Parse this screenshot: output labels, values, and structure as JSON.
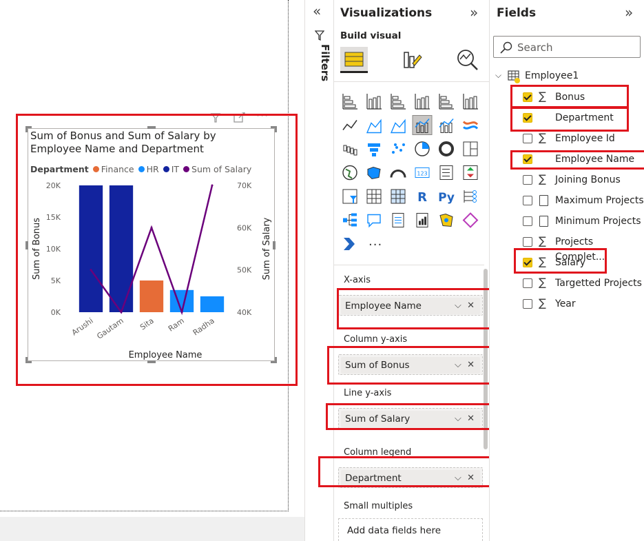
{
  "chart_data": {
    "type": "bar",
    "title": "Sum of Bonus and Sum of Salary by Employee Name and Department",
    "title_lines": [
      "Sum of Bonus and Sum of Salary by",
      "Employee Name and Department"
    ],
    "xlabel": "Employee Name",
    "ylabel": "Sum of Bonus",
    "y2label": "Sum of Salary",
    "ylim": [
      0,
      20000
    ],
    "y2lim": [
      40000,
      70000
    ],
    "yticks": [
      "0K",
      "5K",
      "10K",
      "15K",
      "20K"
    ],
    "y2ticks": [
      "40K",
      "50K",
      "60K",
      "70K"
    ],
    "legend_title": "Department",
    "legend": [
      {
        "name": "Finance",
        "color": "#e66c37"
      },
      {
        "name": "HR",
        "color": "#118dff"
      },
      {
        "name": "IT",
        "color": "#12239e"
      },
      {
        "name": "Sum of Salary",
        "color": "#6b007b"
      }
    ],
    "legend_position": "top-left",
    "grid": false,
    "categories": [
      "Arushi",
      "Gautam",
      "Sita",
      "Ram",
      "Radha"
    ],
    "bars": [
      {
        "category": "Arushi",
        "department": "IT",
        "value": 20000
      },
      {
        "category": "Gautam",
        "department": "IT",
        "value": 20000
      },
      {
        "category": "Sita",
        "department": "Finance",
        "value": 5000
      },
      {
        "category": "Ram",
        "department": "HR",
        "value": 3500
      },
      {
        "category": "Radha",
        "department": "HR",
        "value": 2500
      }
    ],
    "line": {
      "name": "Sum of Salary",
      "values": [
        50000,
        40000,
        60000,
        40000,
        70000
      ]
    }
  },
  "visual_header": {
    "filter_icon": "filter-icon",
    "focus_icon": "focus-mode-icon",
    "more": "···"
  },
  "filters": {
    "label": "Filters",
    "collapse": "«"
  },
  "viz": {
    "title": "Visualizations",
    "expand": "»",
    "build_visual": "Build visual",
    "more_visuals": "···",
    "wells": [
      {
        "label": "X-axis",
        "value": "Employee Name"
      },
      {
        "label": "Column y-axis",
        "value": "Sum of Bonus"
      },
      {
        "label": "Line y-axis",
        "value": "Sum of Salary"
      },
      {
        "label": "Column legend",
        "value": "Department"
      }
    ],
    "small_multiples": "Small multiples",
    "add_fields": "Add data fields here"
  },
  "fields": {
    "title": "Fields",
    "expand": "»",
    "search_placeholder": "Search",
    "table_name": "Employee1",
    "items": [
      {
        "name": "Bonus",
        "checked": true,
        "type": "sum"
      },
      {
        "name": "Department",
        "checked": true,
        "type": "text"
      },
      {
        "name": "Employee Id",
        "checked": false,
        "type": "sum"
      },
      {
        "name": "Employee Name",
        "checked": true,
        "type": "text"
      },
      {
        "name": "Joining Bonus",
        "checked": false,
        "type": "sum"
      },
      {
        "name": "Maximum Projects",
        "checked": false,
        "type": "calc"
      },
      {
        "name": "Minimum Projects",
        "checked": false,
        "type": "calc"
      },
      {
        "name": "Projects Complet...",
        "checked": false,
        "type": "sum"
      },
      {
        "name": "Salary",
        "checked": true,
        "type": "sum"
      },
      {
        "name": "Targetted Projects",
        "checked": false,
        "type": "sum"
      },
      {
        "name": "Year",
        "checked": false,
        "type": "sum"
      }
    ]
  }
}
